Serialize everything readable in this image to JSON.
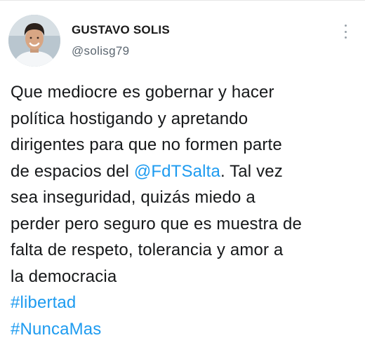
{
  "author": {
    "name": "GUSTAVO SOLIS",
    "handle": "@solisg79"
  },
  "tweet": {
    "lines": [
      "Que mediocre es gobernar y hacer",
      "política hostigando y apretando",
      "dirigentes para que no formen parte",
      "de espacios del ",
      "sea inseguridad, quizás miedo a",
      "perder pero seguro que es muestra de",
      "falta de respeto, tolerancia y amor a",
      "la democracia"
    ],
    "mention": "@FdTSalta",
    "line4_tail": ". Tal vez",
    "hashtags": [
      "#libertad",
      "#NuncaMas"
    ]
  },
  "icons": {
    "more": "more-vertical-icon"
  },
  "colors": {
    "link": "#1d9bf0",
    "text": "#16181a",
    "secondary": "#5b6670"
  }
}
